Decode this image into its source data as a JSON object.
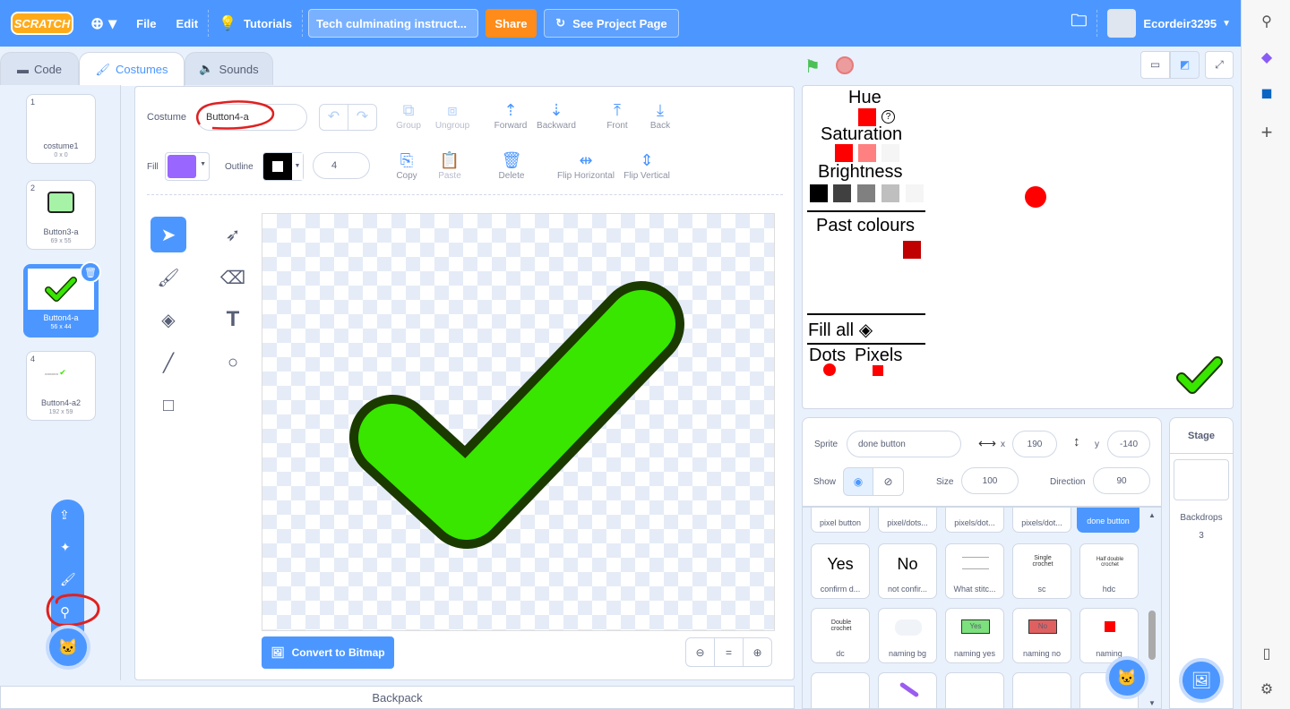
{
  "menu": {
    "logo": "SCRATCH",
    "globe": "⊕ ▾",
    "file": "File",
    "edit": "Edit",
    "tutorials": "Tutorials",
    "project_title": "Tech culminating instruct...",
    "share": "Share",
    "see_project": "See Project Page",
    "username": "Ecordeir3295"
  },
  "tabs": {
    "code": "Code",
    "costumes": "Costumes",
    "sounds": "Sounds"
  },
  "costumes": [
    {
      "num": "1",
      "name": "costume1",
      "size": "0 x 0"
    },
    {
      "num": "2",
      "name": "Button3-a",
      "size": "69 x 55"
    },
    {
      "num": "3",
      "name": "Button4-a",
      "size": "56 x 44"
    },
    {
      "num": "4",
      "name": "Button4-a2",
      "size": "192 x 59"
    }
  ],
  "editor": {
    "costume_label": "Costume",
    "costume_name": "Button4-a",
    "fill_label": "Fill",
    "outline_label": "Outline",
    "outline_width": "4",
    "group": "Group",
    "ungroup": "Ungroup",
    "forward": "Forward",
    "backward": "Backward",
    "front": "Front",
    "back": "Back",
    "copy": "Copy",
    "paste": "Paste",
    "delete": "Delete",
    "flip_h": "Flip Horizontal",
    "flip_v": "Flip Vertical",
    "convert": "Convert to Bitmap",
    "zoom_reset": "="
  },
  "stage": {
    "hue": "Hue",
    "saturation": "Saturation",
    "brightness": "Brightness",
    "past": "Past colours",
    "fillall": "Fill all",
    "dots": "Dots",
    "pixels": "Pixels",
    "q": "?"
  },
  "sprite": {
    "label": "Sprite",
    "name": "done button",
    "x_label": "x",
    "x": "190",
    "y_label": "y",
    "y": "-140",
    "show_label": "Show",
    "size_label": "Size",
    "size": "100",
    "direction_label": "Direction",
    "direction": "90"
  },
  "sprites": [
    {
      "name": "pixel button"
    },
    {
      "name": "pixel/dots..."
    },
    {
      "name": "pixels/dot..."
    },
    {
      "name": "pixels/dot..."
    },
    {
      "name": "done button"
    },
    {
      "name": "confirm d...",
      "thumb": "Yes"
    },
    {
      "name": "not confir...",
      "thumb": "No"
    },
    {
      "name": "What stitc..."
    },
    {
      "name": "sc",
      "thumb": "Single crochet"
    },
    {
      "name": "hdc",
      "thumb": "Half double crochet"
    },
    {
      "name": "dc",
      "thumb": "Double crochet"
    },
    {
      "name": "naming bg"
    },
    {
      "name": "naming yes",
      "thumb": "Yes"
    },
    {
      "name": "naming no",
      "thumb": "No"
    },
    {
      "name": "naming"
    }
  ],
  "stage_panel": {
    "title": "Stage",
    "backdrops": "Backdrops",
    "count": "3"
  },
  "backpack": "Backpack",
  "colors": {
    "blue": "#4c97ff",
    "orange": "#ff8c1a",
    "fill": "#9966ff",
    "check": "#38e600"
  }
}
